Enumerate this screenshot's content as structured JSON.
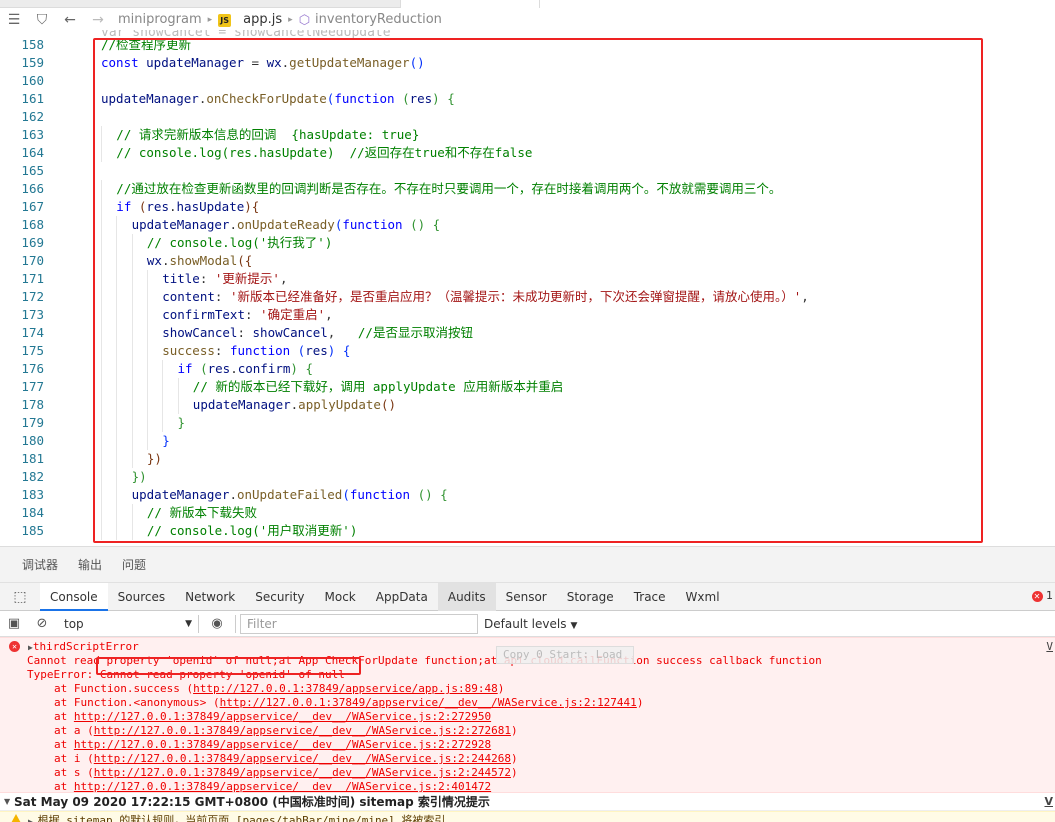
{
  "breadcrumb": {
    "project": "miniprogram",
    "file_badge": "JS",
    "file": "app.js",
    "symbol": "inventoryReduction"
  },
  "ghost_line": "var showCancel = showCancelNeedUpdate",
  "code_lines": [
    {
      "n": "158",
      "parts": [
        {
          "t": "//检查程序更新",
          "c": "comment"
        }
      ]
    },
    {
      "n": "159",
      "parts": [
        {
          "t": "const ",
          "c": "kw"
        },
        {
          "t": "updateManager",
          "c": "var"
        },
        {
          "t": " = ",
          "c": "plain"
        },
        {
          "t": "wx",
          "c": "var"
        },
        {
          "t": ".",
          "c": "plain"
        },
        {
          "t": "getUpdateManager",
          "c": "fn"
        },
        {
          "t": "()",
          "c": "paren"
        }
      ]
    },
    {
      "n": "160",
      "parts": []
    },
    {
      "n": "161",
      "parts": [
        {
          "t": "updateManager",
          "c": "var"
        },
        {
          "t": ".",
          "c": "plain"
        },
        {
          "t": "onCheckForUpdate",
          "c": "fn"
        },
        {
          "t": "(",
          "c": "paren"
        },
        {
          "t": "function ",
          "c": "kw"
        },
        {
          "t": "(",
          "c": "paren2"
        },
        {
          "t": "res",
          "c": "var"
        },
        {
          "t": ") {",
          "c": "paren2"
        }
      ]
    },
    {
      "n": "162",
      "parts": []
    },
    {
      "n": "163",
      "indent": 1,
      "parts": [
        {
          "t": "// 请求完新版本信息的回调  {hasUpdate: true}",
          "c": "comment"
        }
      ]
    },
    {
      "n": "164",
      "indent": 1,
      "parts": [
        {
          "t": "// console.log(res.hasUpdate)  //返回存在true和不存在false",
          "c": "comment"
        }
      ]
    },
    {
      "n": "165",
      "parts": []
    },
    {
      "n": "166",
      "indent": 1,
      "parts": [
        {
          "t": "//通过放在检查更新函数里的回调判断是否存在。不存在时只要调用一个，存在时接着调用两个。不放就需要调用三个。",
          "c": "comment"
        }
      ]
    },
    {
      "n": "167",
      "indent": 1,
      "parts": [
        {
          "t": "if ",
          "c": "kw"
        },
        {
          "t": "(",
          "c": "paren3"
        },
        {
          "t": "res",
          "c": "var"
        },
        {
          "t": ".",
          "c": "plain"
        },
        {
          "t": "hasUpdate",
          "c": "var"
        },
        {
          "t": "){",
          "c": "paren3"
        }
      ]
    },
    {
      "n": "168",
      "indent": 2,
      "parts": [
        {
          "t": "updateManager",
          "c": "var"
        },
        {
          "t": ".",
          "c": "plain"
        },
        {
          "t": "onUpdateReady",
          "c": "fn"
        },
        {
          "t": "(",
          "c": "paren"
        },
        {
          "t": "function ",
          "c": "kw"
        },
        {
          "t": "() {",
          "c": "paren2"
        }
      ]
    },
    {
      "n": "169",
      "indent": 3,
      "parts": [
        {
          "t": "// console.log('执行我了')",
          "c": "comment"
        }
      ]
    },
    {
      "n": "170",
      "indent": 3,
      "parts": [
        {
          "t": "wx",
          "c": "var"
        },
        {
          "t": ".",
          "c": "plain"
        },
        {
          "t": "showModal",
          "c": "fn"
        },
        {
          "t": "({",
          "c": "paren3"
        }
      ]
    },
    {
      "n": "171",
      "indent": 4,
      "parts": [
        {
          "t": "title",
          "c": "var"
        },
        {
          "t": ": ",
          "c": "plain"
        },
        {
          "t": "'更新提示'",
          "c": "str"
        },
        {
          "t": ",",
          "c": "plain"
        }
      ]
    },
    {
      "n": "172",
      "indent": 4,
      "parts": [
        {
          "t": "content",
          "c": "var"
        },
        {
          "t": ": ",
          "c": "plain"
        },
        {
          "t": "'新版本已经准备好，是否重启应用？（温馨提示：未成功更新时，下次还会弹窗提醒，请放心使用。）'",
          "c": "str"
        },
        {
          "t": ",",
          "c": "plain"
        }
      ]
    },
    {
      "n": "173",
      "indent": 4,
      "parts": [
        {
          "t": "confirmText",
          "c": "var"
        },
        {
          "t": ": ",
          "c": "plain"
        },
        {
          "t": "'确定重启'",
          "c": "str"
        },
        {
          "t": ",",
          "c": "plain"
        }
      ]
    },
    {
      "n": "174",
      "indent": 4,
      "parts": [
        {
          "t": "showCancel",
          "c": "var"
        },
        {
          "t": ": ",
          "c": "plain"
        },
        {
          "t": "showCancel",
          "c": "var"
        },
        {
          "t": ",   ",
          "c": "plain"
        },
        {
          "t": "//是否显示取消按钮",
          "c": "comment"
        }
      ]
    },
    {
      "n": "175",
      "indent": 4,
      "parts": [
        {
          "t": "success",
          "c": "fn"
        },
        {
          "t": ": ",
          "c": "plain"
        },
        {
          "t": "function ",
          "c": "kw"
        },
        {
          "t": "(",
          "c": "paren"
        },
        {
          "t": "res",
          "c": "var"
        },
        {
          "t": ") {",
          "c": "paren"
        }
      ]
    },
    {
      "n": "176",
      "indent": 5,
      "parts": [
        {
          "t": "if ",
          "c": "kw"
        },
        {
          "t": "(",
          "c": "paren2"
        },
        {
          "t": "res",
          "c": "var"
        },
        {
          "t": ".",
          "c": "plain"
        },
        {
          "t": "confirm",
          "c": "var"
        },
        {
          "t": ") {",
          "c": "paren2"
        }
      ]
    },
    {
      "n": "177",
      "indent": 6,
      "parts": [
        {
          "t": "// 新的版本已经下载好，调用 applyUpdate 应用新版本并重启",
          "c": "comment"
        }
      ]
    },
    {
      "n": "178",
      "indent": 6,
      "parts": [
        {
          "t": "updateManager",
          "c": "var"
        },
        {
          "t": ".",
          "c": "plain"
        },
        {
          "t": "applyUpdate",
          "c": "fn"
        },
        {
          "t": "()",
          "c": "paren3"
        }
      ]
    },
    {
      "n": "179",
      "indent": 5,
      "parts": [
        {
          "t": "}",
          "c": "paren2"
        }
      ]
    },
    {
      "n": "180",
      "indent": 4,
      "parts": [
        {
          "t": "}",
          "c": "paren"
        }
      ]
    },
    {
      "n": "181",
      "indent": 3,
      "parts": [
        {
          "t": "})",
          "c": "paren3"
        }
      ]
    },
    {
      "n": "182",
      "indent": 2,
      "parts": [
        {
          "t": "})",
          "c": "paren2"
        }
      ]
    },
    {
      "n": "183",
      "indent": 2,
      "parts": [
        {
          "t": "updateManager",
          "c": "var"
        },
        {
          "t": ".",
          "c": "plain"
        },
        {
          "t": "onUpdateFailed",
          "c": "fn"
        },
        {
          "t": "(",
          "c": "paren"
        },
        {
          "t": "function ",
          "c": "kw"
        },
        {
          "t": "() {",
          "c": "paren2"
        }
      ]
    },
    {
      "n": "184",
      "indent": 3,
      "parts": [
        {
          "t": "// 新版本下载失败",
          "c": "comment"
        }
      ]
    },
    {
      "n": "185",
      "indent": 3,
      "parts": [
        {
          "t": "// console.log('用户取消更新')",
          "c": "comment"
        }
      ]
    }
  ],
  "panel_tabs": [
    "调试器",
    "输出",
    "问题"
  ],
  "devtools_tabs": [
    "Console",
    "Sources",
    "Network",
    "Security",
    "Mock",
    "AppData",
    "Audits",
    "Sensor",
    "Storage",
    "Trace",
    "Wxml"
  ],
  "error_count": "1",
  "console": {
    "context": "top",
    "filter_placeholder": "Filter",
    "levels": "Default levels"
  },
  "error": {
    "header": "thirdScriptError",
    "message": "Cannot read property 'openid' of null;at App CheckForUpdate function;at api cloud.callFunction success callback function",
    "type_prefix": "TypeError: ",
    "type_msg": "Cannot read property 'openid' of null",
    "overlay": "Copy 0 Start: Load",
    "right_link": "V",
    "stack": [
      {
        "pre": "at Function.success (",
        "url": "http://127.0.0.1:37849/appservice/app.js:89:48",
        "post": ")"
      },
      {
        "pre": "at Function.<anonymous> (",
        "url": "http://127.0.0.1:37849/appservice/__dev__/WAService.js:2:127441",
        "post": ")"
      },
      {
        "pre": "at ",
        "url": "http://127.0.0.1:37849/appservice/__dev__/WAService.js:2:272950",
        "post": ""
      },
      {
        "pre": "at a (",
        "url": "http://127.0.0.1:37849/appservice/__dev__/WAService.js:2:272681",
        "post": ")"
      },
      {
        "pre": "at ",
        "url": "http://127.0.0.1:37849/appservice/__dev__/WAService.js:2:272928",
        "post": ""
      },
      {
        "pre": "at i (",
        "url": "http://127.0.0.1:37849/appservice/__dev__/WAService.js:2:244268",
        "post": ")"
      },
      {
        "pre": "at s (",
        "url": "http://127.0.0.1:37849/appservice/__dev__/WAService.js:2:244572",
        "post": ")"
      },
      {
        "pre": "at ",
        "url": "http://127.0.0.1:37849/appservice/__dev__/WAService.js:2:401472",
        "post": ""
      }
    ]
  },
  "group": {
    "text": "Sat May 09 2020 17:22:15 GMT+0800 (中国标准时间) sitemap 索引情况提示",
    "right_link": "V"
  },
  "warning": {
    "text": "根据 sitemap 的默认规则，当前页面 [pages/tabBar/mine/mine] 将被索引"
  },
  "colors": {
    "highlight_box": "#ee2222",
    "error_text": "#ee0000",
    "error_bg": "#fff0f0",
    "active_tab": "#1a73e8"
  },
  "icons": [
    "list-icon",
    "bookmark-icon",
    "back-arrow-icon",
    "forward-arrow-icon",
    "js-file-icon",
    "cube-icon",
    "inspect-icon",
    "device-icon",
    "sidebar-toggle-icon",
    "clear-icon",
    "eye-icon",
    "error-icon",
    "warning-icon"
  ]
}
